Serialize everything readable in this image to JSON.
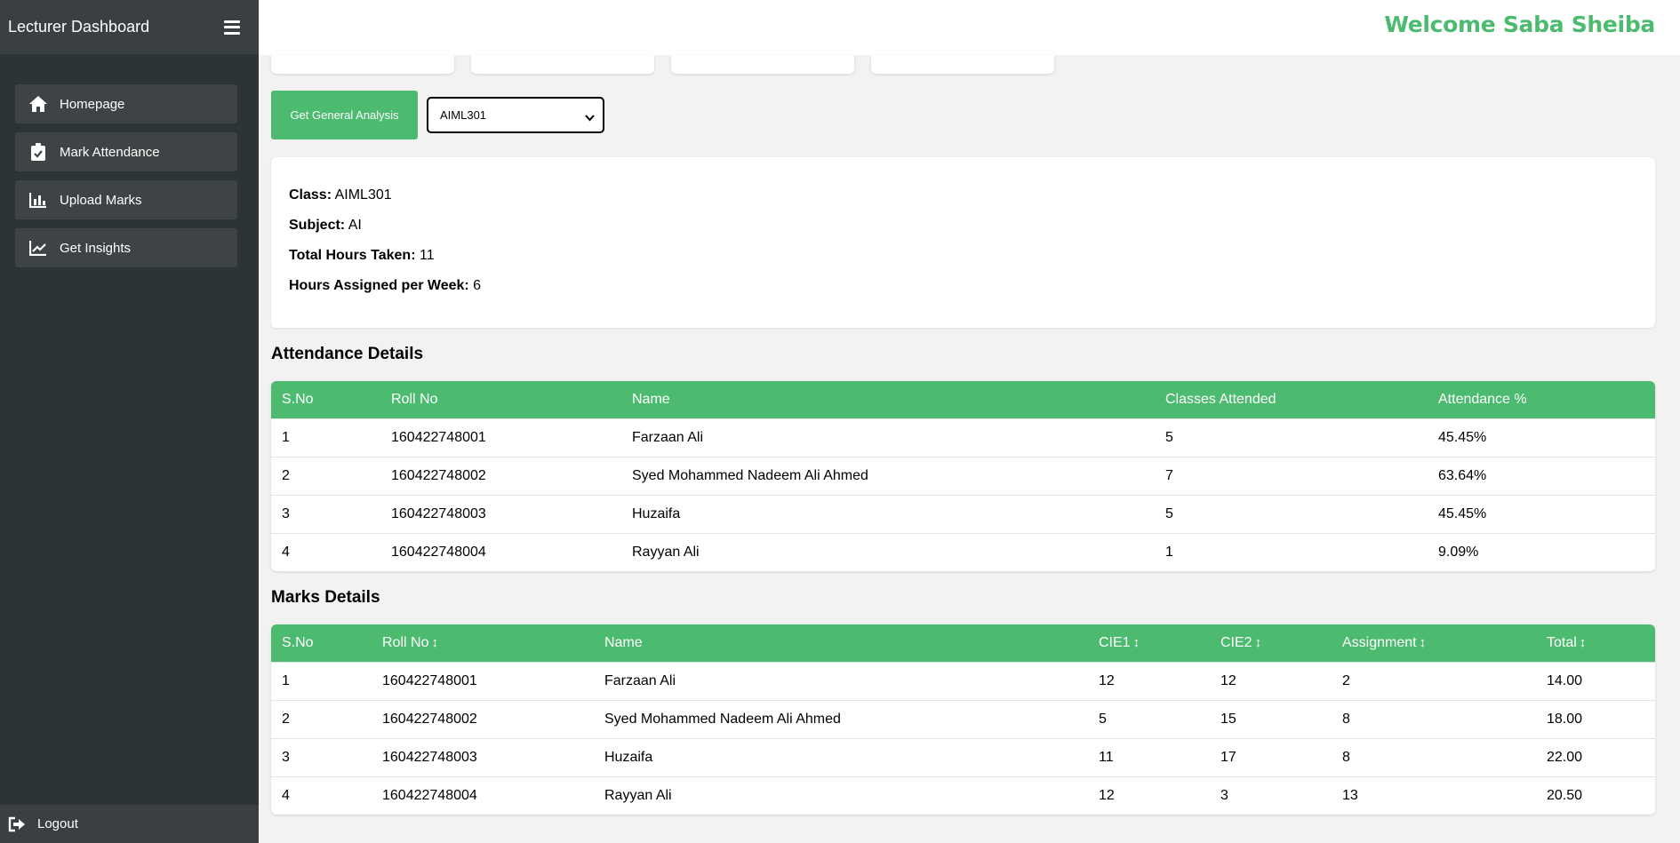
{
  "sidebar": {
    "title": "Lecturer Dashboard",
    "items": [
      {
        "label": "Homepage",
        "icon": "home-icon"
      },
      {
        "label": "Mark Attendance",
        "icon": "clipboard-check-icon"
      },
      {
        "label": "Upload Marks",
        "icon": "bar-chart-icon"
      },
      {
        "label": "Get Insights",
        "icon": "line-chart-icon"
      }
    ],
    "logout": "Logout"
  },
  "header": {
    "welcome": "Welcome Saba Sheiba"
  },
  "controls": {
    "analysis_button": "Get General Analysis",
    "selected_class": "AIML301"
  },
  "info": {
    "class_label": "Class:",
    "class_value": "AIML301",
    "subject_label": "Subject:",
    "subject_value": "AI",
    "hours_label": "Total Hours Taken:",
    "hours_value": "11",
    "weekly_label": "Hours Assigned per Week:",
    "weekly_value": "6"
  },
  "attendance": {
    "title": "Attendance Details",
    "headers": [
      "S.No",
      "Roll No",
      "Name",
      "Classes Attended",
      "Attendance %"
    ],
    "rows": [
      [
        "1",
        "160422748001",
        "Farzaan Ali",
        "5",
        "45.45%"
      ],
      [
        "2",
        "160422748002",
        "Syed Mohammed Nadeem Ali Ahmed",
        "7",
        "63.64%"
      ],
      [
        "3",
        "160422748003",
        "Huzaifa",
        "5",
        "45.45%"
      ],
      [
        "4",
        "160422748004",
        "Rayyan Ali",
        "1",
        "9.09%"
      ]
    ]
  },
  "marks": {
    "title": "Marks Details",
    "headers": [
      "S.No",
      "Roll No",
      "Name",
      "CIE1",
      "CIE2",
      "Assignment",
      "Total"
    ],
    "sort_glyph": "↕",
    "rows": [
      [
        "1",
        "160422748001",
        "Farzaan Ali",
        "12",
        "12",
        "2",
        "14.00"
      ],
      [
        "2",
        "160422748002",
        "Syed Mohammed Nadeem Ali Ahmed",
        "5",
        "15",
        "8",
        "18.00"
      ],
      [
        "3",
        "160422748003",
        "Huzaifa",
        "11",
        "17",
        "8",
        "22.00"
      ],
      [
        "4",
        "160422748004",
        "Rayyan Ali",
        "12",
        "3",
        "13",
        "20.50"
      ]
    ]
  },
  "colors": {
    "accent": "#4cbb70",
    "sidebar": "#2d3436"
  }
}
